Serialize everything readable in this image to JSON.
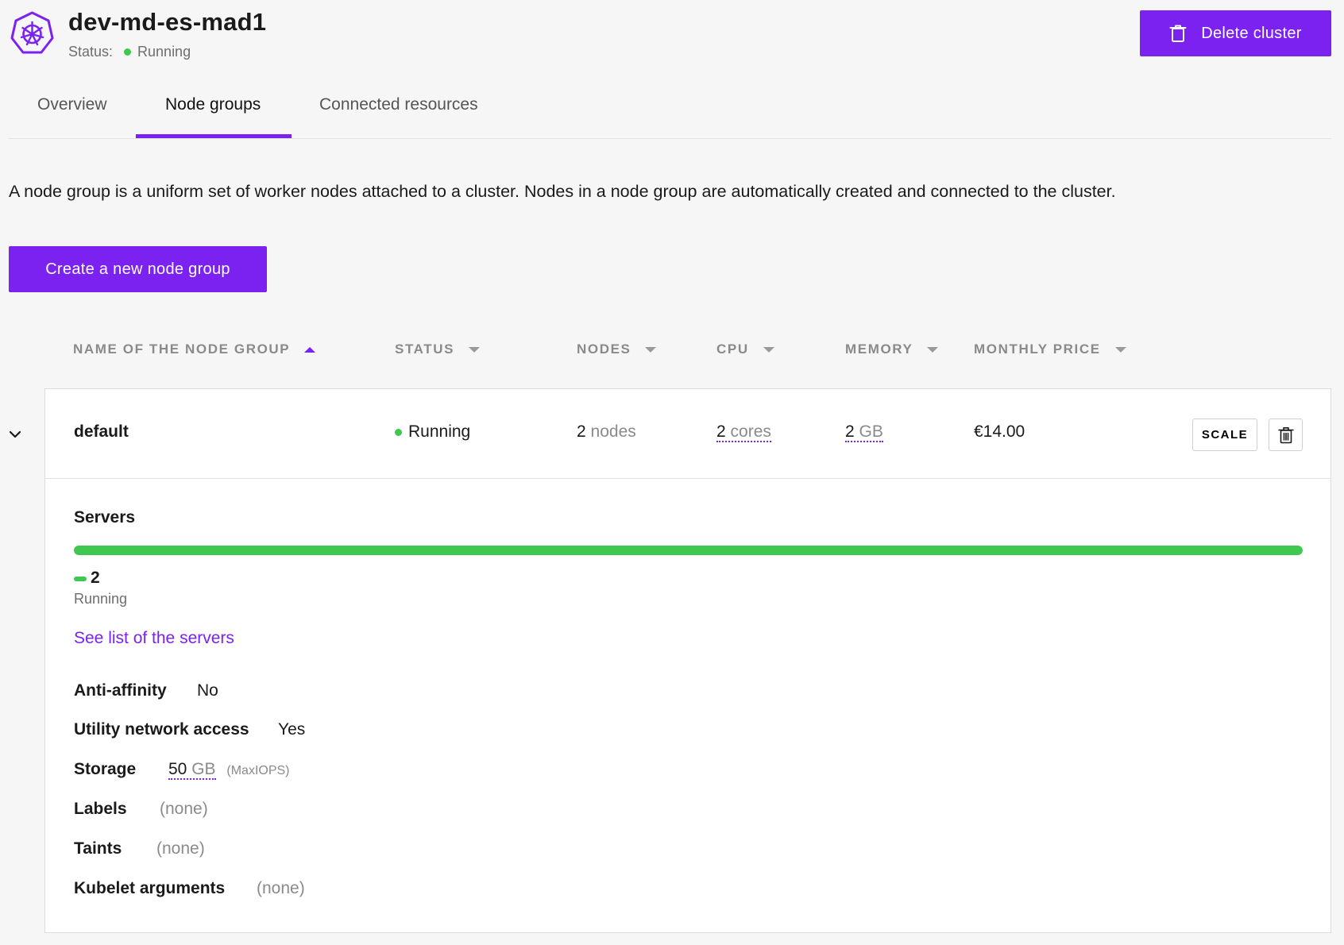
{
  "header": {
    "cluster_name": "dev-md-es-mad1",
    "status_label": "Status:",
    "status_value": "Running",
    "delete_button": "Delete cluster"
  },
  "tabs": [
    {
      "label": "Overview",
      "active": false
    },
    {
      "label": "Node groups",
      "active": true
    },
    {
      "label": "Connected resources",
      "active": false
    }
  ],
  "description": "A node group is a uniform set of worker nodes attached to a cluster. Nodes in a node group are automatically created and connected to the cluster.",
  "create_button": "Create a new node group",
  "table": {
    "columns": [
      {
        "label": "NAME OF THE NODE GROUP",
        "sort": "asc"
      },
      {
        "label": "STATUS",
        "sort": "none"
      },
      {
        "label": "NODES",
        "sort": "none"
      },
      {
        "label": "CPU",
        "sort": "none"
      },
      {
        "label": "MEMORY",
        "sort": "none"
      },
      {
        "label": "MONTHLY PRICE",
        "sort": "none"
      }
    ],
    "rows": [
      {
        "name": "default",
        "status": "Running",
        "nodes_count": "2",
        "nodes_unit": "nodes",
        "cpu_count": "2",
        "cpu_unit": "cores",
        "memory_count": "2",
        "memory_unit": "GB",
        "price": "€14.00",
        "scale_button": "SCALE",
        "expanded": true,
        "details": {
          "servers_title": "Servers",
          "running_fraction": 1.0,
          "running_count": "2",
          "running_label": "Running",
          "servers_link": "See list of the servers",
          "anti_affinity_label": "Anti-affinity",
          "anti_affinity_value": "No",
          "utility_label": "Utility network access",
          "utility_value": "Yes",
          "storage_label": "Storage",
          "storage_count": "50",
          "storage_unit": "GB",
          "storage_type": "(MaxIOPS)",
          "labels_label": "Labels",
          "labels_value": "(none)",
          "taints_label": "Taints",
          "taints_value": "(none)",
          "kubelet_label": "Kubelet arguments",
          "kubelet_value": "(none)"
        }
      }
    ]
  },
  "colors": {
    "accent": "#7b22f0",
    "running": "#3ec84f",
    "background": "#f6f6f6"
  },
  "icons": [
    "kubernetes-logo-icon",
    "trash-icon",
    "chevron-down-icon",
    "sort-arrow-icon"
  ]
}
